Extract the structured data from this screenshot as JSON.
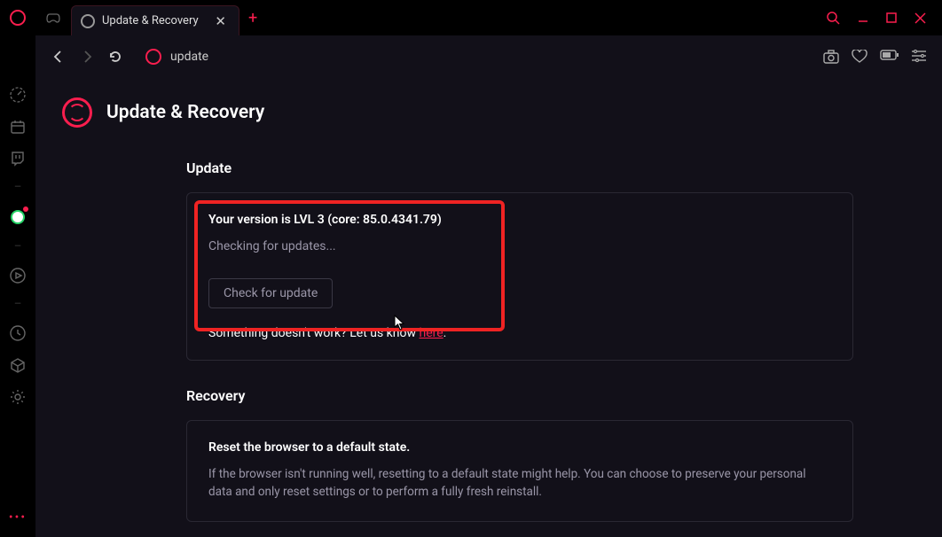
{
  "tab": {
    "title": "Update & Recovery"
  },
  "addressbar": {
    "text": "update"
  },
  "page": {
    "title": "Update & Recovery"
  },
  "update": {
    "section_title": "Update",
    "version_prefix": "Your version is",
    "version_level": "LVL 3",
    "version_core": "(core: 85.0.4341.79)",
    "status": "Checking for updates...",
    "check_button": "Check for update",
    "help_text": "Something doesn't work? Let us know ",
    "help_link": "here",
    "help_suffix": "."
  },
  "recovery": {
    "section_title": "Recovery",
    "heading": "Reset the browser to a default state.",
    "body": "If the browser isn't running well, resetting to a default state might help. You can choose to preserve your personal data and only reset settings or to perform a fully fresh reinstall."
  }
}
